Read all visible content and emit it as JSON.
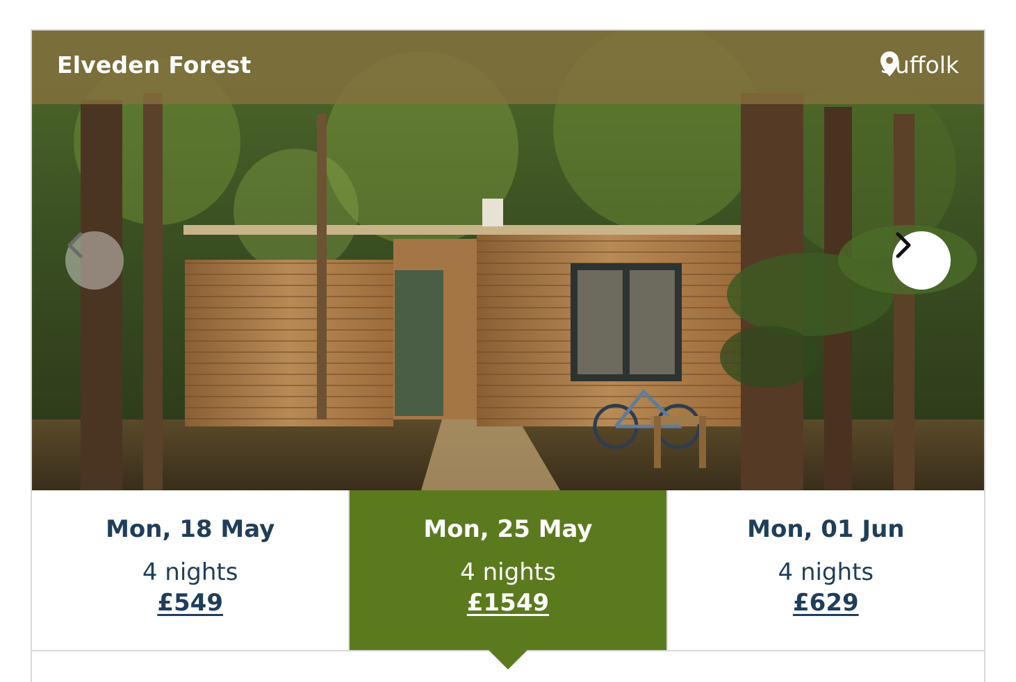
{
  "card": {
    "place_name": "Elveden Forest",
    "region": "Suffolk",
    "icons": {
      "location": "map-pin-icon",
      "prev": "chevron-left-icon",
      "next": "chevron-right-icon"
    },
    "image_alt": "Wooden lodge with a bicycle among forest trees"
  },
  "dates": [
    {
      "label": "Mon, 18 May",
      "nights": "4 nights",
      "price": "£549",
      "selected": false
    },
    {
      "label": "Mon, 25 May",
      "nights": "4 nights",
      "price": "£1549",
      "selected": true
    },
    {
      "label": "Mon, 01 Jun",
      "nights": "4 nights",
      "price": "£629",
      "selected": false
    }
  ],
  "colors": {
    "title_bar": "#86703e",
    "selected_bg": "#5b7a1d",
    "text_dark": "#1f3e5a",
    "border": "#d9d9d9"
  }
}
